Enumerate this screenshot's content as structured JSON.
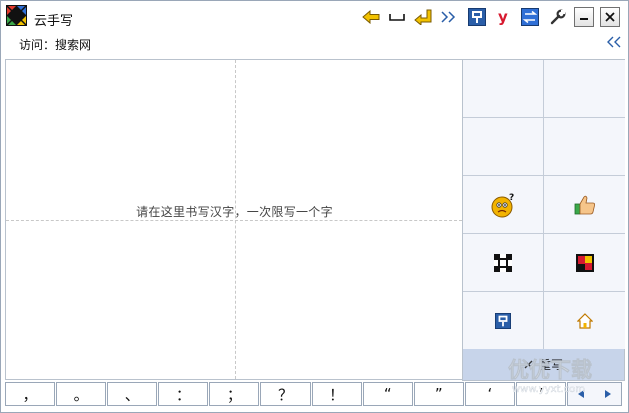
{
  "app": {
    "title": "云手写"
  },
  "visit": {
    "label": "访问：",
    "site": "搜索网"
  },
  "pad": {
    "hint": "请在这里书写汉字，一次限写一个字"
  },
  "panel": {
    "rewrite_label": "重写"
  },
  "punctuation": [
    "，",
    "。",
    "、",
    "：",
    "；",
    "？",
    "！",
    "“",
    "”",
    "‘",
    "’"
  ],
  "watermark": {
    "line1": "优优下载",
    "line2": "www.yyxt.com"
  },
  "colors": {
    "accent": "#c7d4ea",
    "panel_bg": "#f4f6fb",
    "border": "#9aa7b8",
    "icon_yellow": "#f2c200",
    "icon_blue": "#2a5ea8",
    "icon_red": "#d7192f"
  }
}
